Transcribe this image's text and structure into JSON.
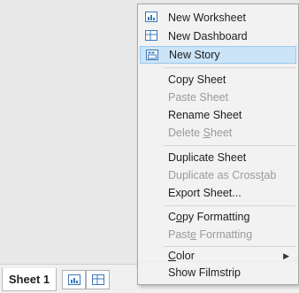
{
  "tabs": {
    "sheet1_label": "Sheet 1",
    "new_worksheet_icon": "new-worksheet-icon",
    "new_dashboard_icon": "new-dashboard-icon"
  },
  "menu": {
    "new_worksheet": "New Worksheet",
    "new_dashboard": "New Dashboard",
    "new_story": "New Story",
    "copy_sheet": "Copy Sheet",
    "paste_sheet": "Paste Sheet",
    "rename_sheet": "Rename Sheet",
    "delete_sheet": {
      "pre": "Delete ",
      "ul": "S",
      "post": "heet"
    },
    "duplicate_sheet": "Duplicate Sheet",
    "duplicate_crosstab": {
      "pre": "Duplicate as Cross",
      "ul": "t",
      "post": "ab"
    },
    "export_sheet": "Export Sheet...",
    "copy_formatting": {
      "pre": "C",
      "ul": "o",
      "post": "py Formatting"
    },
    "paste_formatting": {
      "pre": "Past",
      "ul": "e",
      "post": " Formatting"
    },
    "color": {
      "pre": "",
      "ul": "C",
      "post": "olor"
    },
    "show_filmstrip": "Show Filmstrip"
  },
  "colors": {
    "highlight": "#cce4f7",
    "disabled_text": "#9a9a9a",
    "icon_blue": "#3a78b8"
  }
}
